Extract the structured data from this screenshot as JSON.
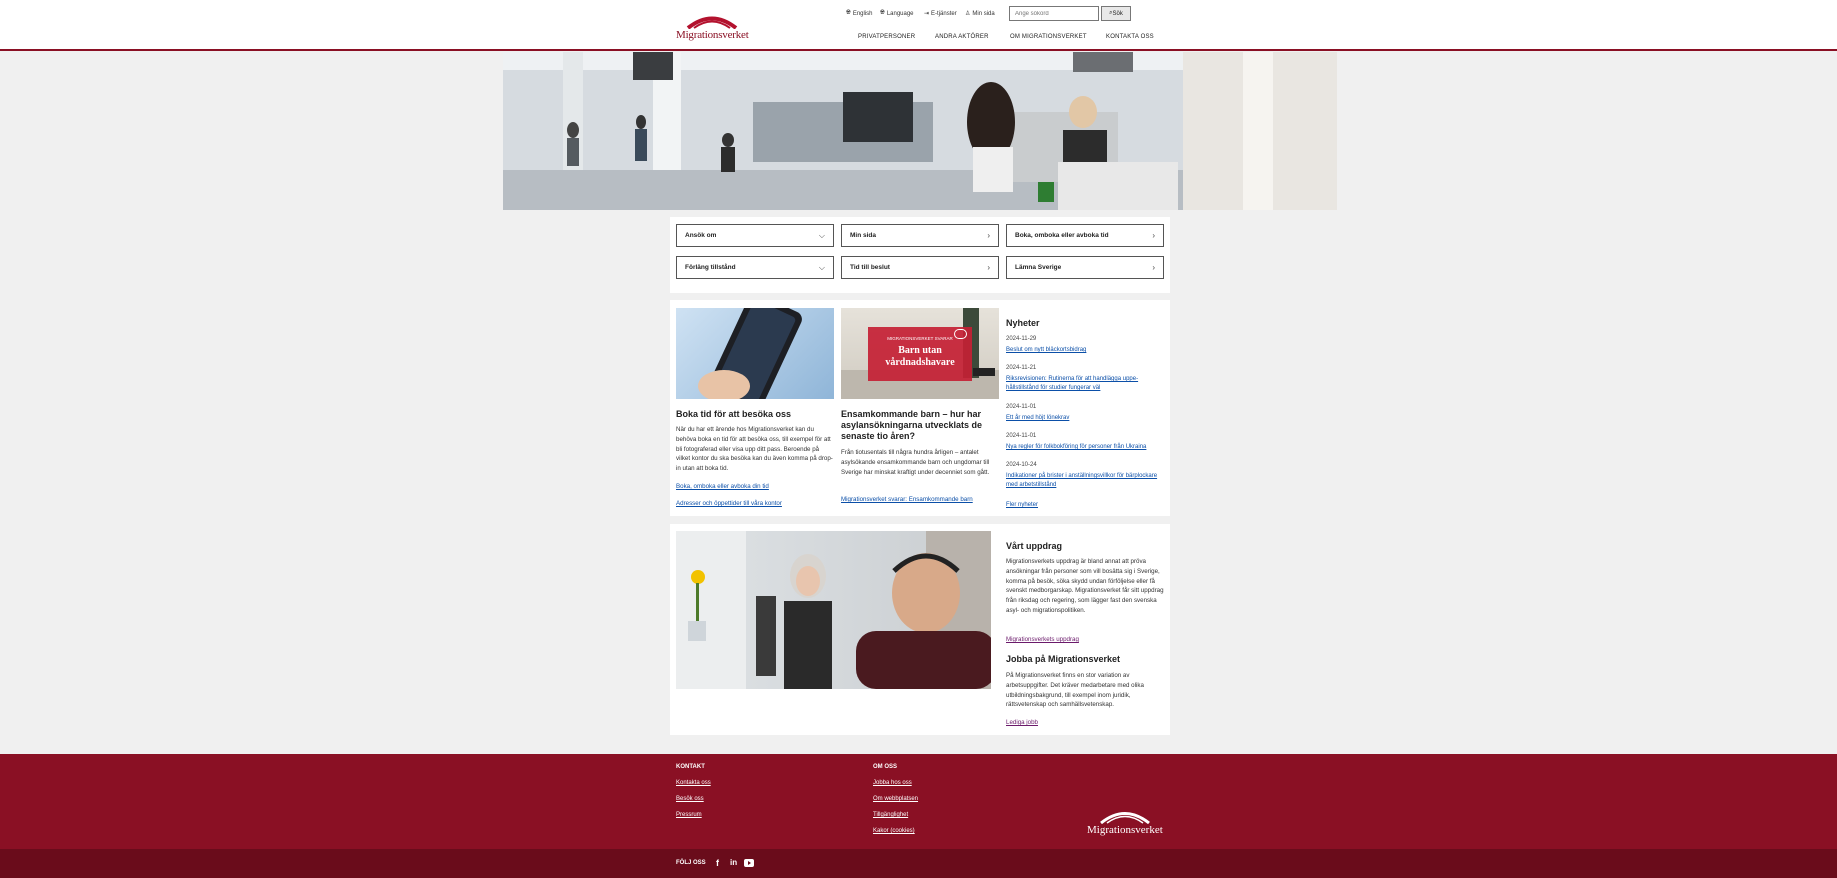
{
  "header": {
    "logo_text": "Migrationsverket",
    "utility": [
      {
        "label": "English",
        "icon": "globe-icon"
      },
      {
        "label": "Language",
        "icon": "globe-icon"
      },
      {
        "label": "E-tjänster",
        "icon": "login-icon"
      },
      {
        "label": "Min sida",
        "icon": "user-icon"
      }
    ],
    "search": {
      "placeholder": "Ange sökord",
      "button_label": "Sök"
    },
    "nav": [
      "Privatpersoner",
      "Andra aktörer",
      "Om Migrationsverket",
      "Kontakta oss"
    ]
  },
  "quick_links": [
    {
      "label": "Ansök om",
      "icon": "chevron-down-icon",
      "glyph": "⌵"
    },
    {
      "label": "Min sida",
      "icon": "chevron-right-icon",
      "glyph": "›"
    },
    {
      "label": "Boka, omboka eller avboka tid",
      "icon": "chevron-right-icon",
      "glyph": "›"
    },
    {
      "label": "Förläng tillstånd",
      "icon": "chevron-down-icon",
      "glyph": "⌵"
    },
    {
      "label": "Tid till beslut",
      "icon": "chevron-right-icon",
      "glyph": "›"
    },
    {
      "label": "Lämna Sverige",
      "icon": "chevron-right-icon",
      "glyph": "›"
    }
  ],
  "cards": [
    {
      "title": "Boka tid för att besöka oss",
      "text": "När du har ett ärende hos Migrationsverket kan du behöva boka en tid för att besöka oss, till exempel för att bli fotograferad eller visa upp ditt pass. Beroende på vilket kontor du ska besöka kan du även komma på drop-in utan att boka tid.",
      "links": [
        "Boka, omboka eller avboka din tid",
        "Adresser och öppettider till våra kontor"
      ]
    },
    {
      "badge_small": "MIGRATIONSVERKET SVARAR",
      "badge_title": "Barn utan vårdnadshavare",
      "title": "Ensamkommande barn – hur har asylansökningarna utvecklats de senaste tio åren?",
      "text": "Från tiotusentals till några hundra årligen – antalet asylsökande ensamkommande barn och ungdomar till Sverige har minskat kraftigt under decenniet som gått.",
      "links": [
        "Migrationsverket svarar: Ensamkommande barn"
      ]
    }
  ],
  "news": {
    "heading": "Nyheter",
    "items": [
      {
        "date": "2024-11-29",
        "title": "Beslut om nytt bläckortsbidrag"
      },
      {
        "date": "2024-11-21",
        "title": "Riksrevisionen: Rutinerna för att handlägga uppe-hållstillstånd för studier fungerar väl"
      },
      {
        "date": "2024-11-01",
        "title": "Ett år med höjt lönekrav"
      },
      {
        "date": "2024-11-01",
        "title": "Nya regler för folkbokföring för personer från Ukraina"
      },
      {
        "date": "2024-10-24",
        "title": "Indikationer på brister i anställningsvillkor för bärplockare med arbetstillstånd"
      }
    ],
    "more": "Fler nyheter"
  },
  "mission": {
    "heading": "Vårt uppdrag",
    "text": "Migrationsverkets uppdrag är bland annat att pröva ansökningar från personer som vill bosätta sig i Sverige, komma på besök, söka skydd undan förföljelse eller få svenskt medborgarskap. Migrationsverket får sitt uppdrag från riksdag och regering, som lägger fast den svenska asyl- och migrationspolitiken.",
    "link": "Migrationsverkets uppdrag"
  },
  "jobs": {
    "heading": "Jobba på Migrationsverket",
    "text": "På Migrationsverket finns en stor variation av arbetsuppgifter. Det kräver medarbetare med olika utbildningsbakgrund, till exempel inom juridik, rättsvetenskap och samhällsvetenskap.",
    "link": "Lediga jobb"
  },
  "footer": {
    "contact_heading": "Kontakt",
    "contact_links": [
      "Kontakta oss",
      "Besök oss",
      "Pressrum"
    ],
    "about_heading": "Om oss",
    "about_links": [
      "Jobba hos oss",
      "Om webbplatsen",
      "Tillgänglighet",
      "Kakor (cookies)"
    ],
    "logo_text": "Migrationsverket",
    "follow": "Följ oss",
    "social": [
      "facebook-icon",
      "linkedin-icon",
      "youtube-icon"
    ]
  },
  "colors": {
    "brand": "#8a1024",
    "brand_dark": "#6a0c1b",
    "link": "#0b4fa8"
  }
}
